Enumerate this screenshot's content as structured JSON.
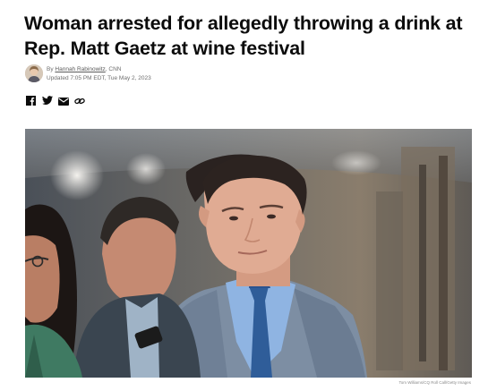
{
  "article": {
    "headline": "Woman arrested for allegedly throwing a drink at Rep. Matt Gaetz at wine festival",
    "byline_prefix": "By ",
    "author": "Hannah Rabinowitz",
    "outlet": ", CNN",
    "updated": "Updated 7:05 PM EDT, Tue May 2, 2023",
    "photo_credit": "Tom Williams/CQ Roll Call/Getty Images"
  },
  "share": {
    "icons": [
      "facebook-icon",
      "twitter-icon",
      "email-icon",
      "link-icon"
    ]
  },
  "colors": {
    "text": "#0c0c0c",
    "meta": "#6e6e6e",
    "suit": "#7d8ea3",
    "tie": "#2f5d99"
  }
}
